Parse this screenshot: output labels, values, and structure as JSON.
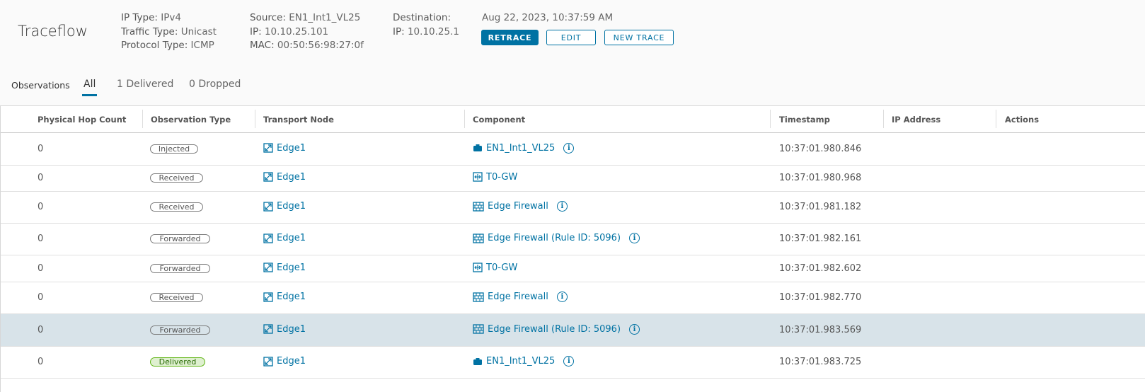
{
  "header": {
    "title": "Traceflow",
    "ip_type": {
      "label": "IP Type:",
      "value": "IPv4"
    },
    "traffic_type": {
      "label": "Traffic Type:",
      "value": "Unicast"
    },
    "protocol_type": {
      "label": "Protocol Type:",
      "value": "ICMP"
    },
    "source": {
      "label": "Source:",
      "value": "EN1_Int1_VL25"
    },
    "source_ip": {
      "label": "IP:",
      "value": "10.10.25.101"
    },
    "source_mac": {
      "label": "MAC:",
      "value": "00:50:56:98:27:0f"
    },
    "destination": {
      "label": "Destination:"
    },
    "destination_ip": {
      "label": "IP:",
      "value": "10.10.25.1"
    },
    "timestamp": "Aug 22, 2023, 10:37:59 AM",
    "buttons": {
      "retrace": "RETRACE",
      "edit": "EDIT",
      "new_trace": "NEW TRACE"
    }
  },
  "tabs": {
    "label": "Observations",
    "all": "All",
    "delivered": "1 Delivered",
    "dropped": "0 Dropped",
    "active": "All"
  },
  "table": {
    "columns": {
      "hop": "Physical Hop Count",
      "type": "Observation Type",
      "node": "Transport Node",
      "component": "Component",
      "timestamp": "Timestamp",
      "ip": "IP Address",
      "actions": "Actions"
    },
    "rows": [
      {
        "hop": "0",
        "type": "Injected",
        "node": "Edge1",
        "component": "EN1_Int1_VL25",
        "component_icon": "segment-port-icon",
        "info": true,
        "timestamp": "10:37:01.980.846"
      },
      {
        "hop": "0",
        "type": "Received",
        "node": "Edge1",
        "component": "T0-GW",
        "component_icon": "router-icon",
        "info": false,
        "timestamp": "10:37:01.980.968"
      },
      {
        "hop": "0",
        "type": "Received",
        "node": "Edge1",
        "component": "Edge Firewall",
        "component_icon": "firewall-icon",
        "info": true,
        "timestamp": "10:37:01.981.182"
      },
      {
        "hop": "0",
        "type": "Forwarded",
        "node": "Edge1",
        "component": "Edge Firewall (Rule ID: 5096)",
        "component_icon": "firewall-icon",
        "info": true,
        "timestamp": "10:37:01.982.161"
      },
      {
        "hop": "0",
        "type": "Forwarded",
        "node": "Edge1",
        "component": "T0-GW",
        "component_icon": "router-icon",
        "info": false,
        "timestamp": "10:37:01.982.602"
      },
      {
        "hop": "0",
        "type": "Received",
        "node": "Edge1",
        "component": "Edge Firewall",
        "component_icon": "firewall-icon",
        "info": true,
        "timestamp": "10:37:01.982.770"
      },
      {
        "hop": "0",
        "type": "Forwarded",
        "node": "Edge1",
        "component": "Edge Firewall (Rule ID: 5096)",
        "component_icon": "firewall-icon",
        "info": true,
        "timestamp": "10:37:01.983.569",
        "selected": true
      },
      {
        "hop": "0",
        "type": "Delivered",
        "node": "Edge1",
        "component": "EN1_Int1_VL25",
        "component_icon": "segment-port-icon",
        "info": true,
        "timestamp": "10:37:01.983.725"
      }
    ]
  },
  "colors": {
    "accent": "#0072a3",
    "selected_row": "#d8e3e9",
    "delivered_bg": "#dff0d0",
    "delivered_border": "#60b515"
  }
}
